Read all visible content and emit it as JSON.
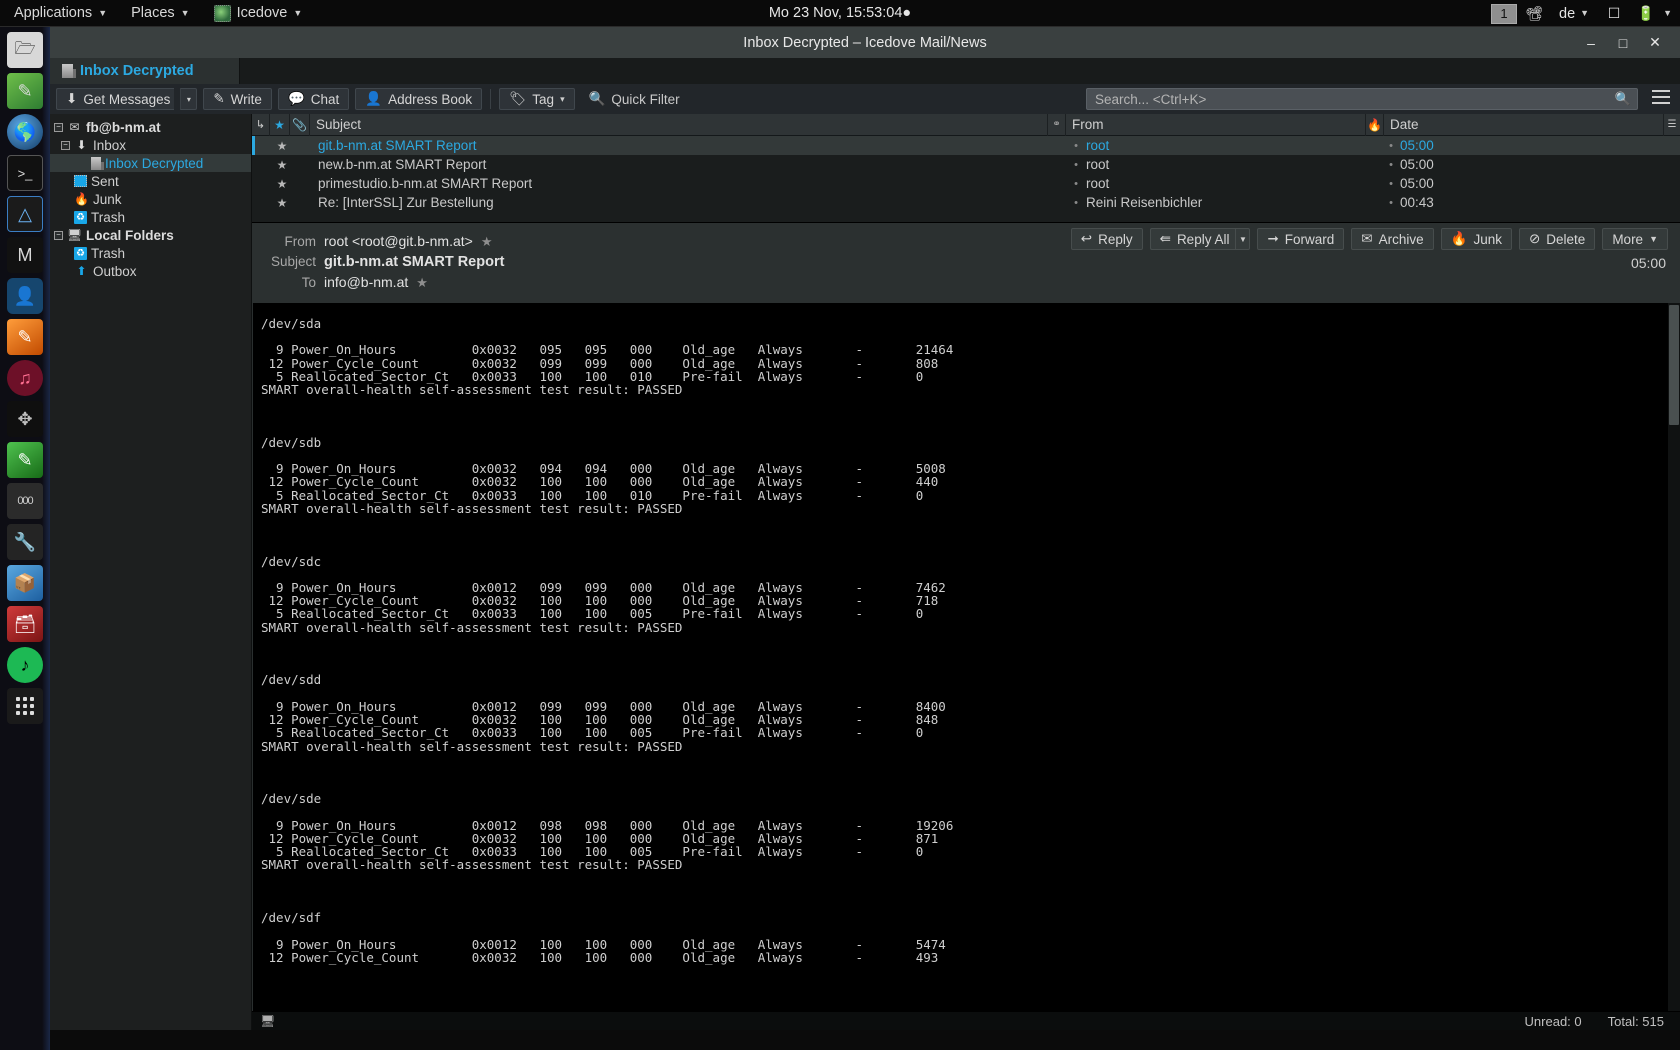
{
  "desktop": {
    "menus": [
      {
        "label": "Applications",
        "icon": "chevron-down-icon"
      },
      {
        "label": "Places",
        "icon": "chevron-down-icon"
      },
      {
        "label": "Icedove",
        "icon": "icedove-app-icon"
      }
    ],
    "clock": "Mo 23 Nov, 15:53:04",
    "clock_dot": "●",
    "tray": {
      "workspace": "1",
      "network_icon": "network-icon",
      "keyboard_layout": "de",
      "display_icon": "display-icon",
      "battery_icon": "battery-icon",
      "caret": "▾"
    },
    "dock_icons": [
      "files-icon",
      "text-editor-icon",
      "web-browser-icon",
      "terminal-icon",
      "audio-editor-icon",
      "mail-icon",
      "contacts-icon",
      "image-editor-icon",
      "media-player-icon",
      "network-tool-icon",
      "notes-icon",
      "calculator-icon",
      "utilities-icon",
      "package-manager-icon",
      "database-icon",
      "spotify-icon",
      "show-applications-icon"
    ]
  },
  "window": {
    "title": "Inbox Decrypted – Icedove Mail/News",
    "controls": {
      "minimize": "–",
      "maximize": "□",
      "close": "✕"
    }
  },
  "tabs": [
    {
      "label": "Inbox Decrypted",
      "icon": "folder-tab-icon",
      "active": true
    }
  ],
  "toolbar": {
    "get_messages": "Get Messages",
    "get_messages_caret": "▾",
    "write": "Write",
    "chat": "Chat",
    "address_book": "Address Book",
    "tag": "Tag",
    "tag_caret": "▾",
    "quick_filter": "Quick Filter",
    "search_placeholder": "Search... <Ctrl+K>",
    "search_value": "",
    "icons": {
      "get_messages": "download-icon",
      "write": "pencil-icon",
      "chat": "chat-bubble-icon",
      "address_book": "person-icon",
      "tag": "tag-icon",
      "quick_filter": "magnifier-icon",
      "search": "magnifier-icon",
      "app_menu": "hamburger-menu-icon"
    }
  },
  "folders": [
    {
      "label": "fb@b-nm.at",
      "indent": 0,
      "twisty": "−",
      "icon": "account-mail-icon",
      "bold": true,
      "selected": false
    },
    {
      "label": "Inbox",
      "indent": 1,
      "twisty": "−",
      "icon": "inbox-icon",
      "bold": false,
      "selected": false
    },
    {
      "label": "Inbox Decrypted",
      "indent": 2,
      "twisty": "",
      "icon": "subfolder-icon",
      "bold": false,
      "selected": true
    },
    {
      "label": "Sent",
      "indent": 1,
      "twisty": "",
      "icon": "sent-icon",
      "bold": false,
      "selected": false
    },
    {
      "label": "Junk",
      "indent": 1,
      "twisty": "",
      "icon": "junk-icon",
      "bold": false,
      "selected": false
    },
    {
      "label": "Trash",
      "indent": 1,
      "twisty": "",
      "icon": "trash-icon",
      "bold": false,
      "selected": false
    },
    {
      "label": "Local Folders",
      "indent": 0,
      "twisty": "−",
      "icon": "local-folders-icon",
      "bold": true,
      "selected": false
    },
    {
      "label": "Trash",
      "indent": 1,
      "twisty": "",
      "icon": "trash-icon",
      "bold": false,
      "selected": false
    },
    {
      "label": "Outbox",
      "indent": 1,
      "twisty": "",
      "icon": "outbox-icon",
      "bold": false,
      "selected": false
    }
  ],
  "message_list": {
    "columns": {
      "thread": "↳",
      "star": "★",
      "attachment": "Ὄe",
      "subject": "Subject",
      "from": "From",
      "date": "Date"
    },
    "rows": [
      {
        "star": "★",
        "subject": "git.b-nm.at SMART Report",
        "from": "root",
        "date": "05:00",
        "selected": true
      },
      {
        "star": "★",
        "subject": "new.b-nm.at SMART Report",
        "from": "root",
        "date": "05:00",
        "selected": false
      },
      {
        "star": "★",
        "subject": "primestudio.b-nm.at SMART Report",
        "from": "root",
        "date": "05:00",
        "selected": false
      },
      {
        "star": "★",
        "subject": "Re: [InterSSL] Zur Bestellung",
        "from": "Reini Reisenbichler",
        "date": "00:43",
        "selected": false
      }
    ]
  },
  "reader": {
    "from_label": "From",
    "from_value": "root <root@git.b-nm.at>",
    "subject_label": "Subject",
    "subject_value": "git.b-nm.at SMART Report",
    "to_label": "To",
    "to_value": "info@b-nm.at",
    "time": "05:00",
    "star": "★",
    "actions": [
      {
        "label": "Reply",
        "icon": "reply-arrow-icon",
        "has_caret": false
      },
      {
        "label": "Reply All",
        "icon": "reply-all-arrow-icon",
        "has_caret": true
      },
      {
        "label": "Forward",
        "icon": "forward-arrow-icon",
        "has_caret": false
      },
      {
        "label": "Archive",
        "icon": "archive-box-icon",
        "has_caret": false
      },
      {
        "label": "Junk",
        "icon": "flame-icon",
        "has_caret": false
      },
      {
        "label": "Delete",
        "icon": "no-entry-icon",
        "has_caret": false
      },
      {
        "label": "More",
        "icon": "",
        "has_caret": true
      }
    ],
    "body": "/dev/sda\n\n  9 Power_On_Hours          0x0032   095   095   000    Old_age   Always       -       21464\n 12 Power_Cycle_Count       0x0032   099   099   000    Old_age   Always       -       808\n  5 Reallocated_Sector_Ct   0x0033   100   100   010    Pre-fail  Always       -       0\nSMART overall-health self-assessment test result: PASSED\n\n\n\n/dev/sdb\n\n  9 Power_On_Hours          0x0032   094   094   000    Old_age   Always       -       5008\n 12 Power_Cycle_Count       0x0032   100   100   000    Old_age   Always       -       440\n  5 Reallocated_Sector_Ct   0x0033   100   100   010    Pre-fail  Always       -       0\nSMART overall-health self-assessment test result: PASSED\n\n\n\n/dev/sdc\n\n  9 Power_On_Hours          0x0012   099   099   000    Old_age   Always       -       7462\n 12 Power_Cycle_Count       0x0032   100   100   000    Old_age   Always       -       718\n  5 Reallocated_Sector_Ct   0x0033   100   100   005    Pre-fail  Always       -       0\nSMART overall-health self-assessment test result: PASSED\n\n\n\n/dev/sdd\n\n  9 Power_On_Hours          0x0012   099   099   000    Old_age   Always       -       8400\n 12 Power_Cycle_Count       0x0032   100   100   000    Old_age   Always       -       848\n  5 Reallocated_Sector_Ct   0x0033   100   100   005    Pre-fail  Always       -       0\nSMART overall-health self-assessment test result: PASSED\n\n\n\n/dev/sde\n\n  9 Power_On_Hours          0x0012   098   098   000    Old_age   Always       -       19206\n 12 Power_Cycle_Count       0x0032   100   100   000    Old_age   Always       -       871\n  5 Reallocated_Sector_Ct   0x0033   100   100   005    Pre-fail  Always       -       0\nSMART overall-health self-assessment test result: PASSED\n\n\n\n/dev/sdf\n\n  9 Power_On_Hours          0x0012   100   100   000    Old_age   Always       -       5474\n 12 Power_Cycle_Count       0x0032   100   100   000    Old_age   Always       -       493"
  },
  "statusbar": {
    "unread": "Unread: 0",
    "total": "Total: 515"
  },
  "colors": {
    "accent": "#2ca9e1",
    "window_chrome": "#3a4040",
    "toolbar_bg": "#22262a",
    "folder_bg": "#1d1f1f",
    "body_bg": "#000000"
  }
}
